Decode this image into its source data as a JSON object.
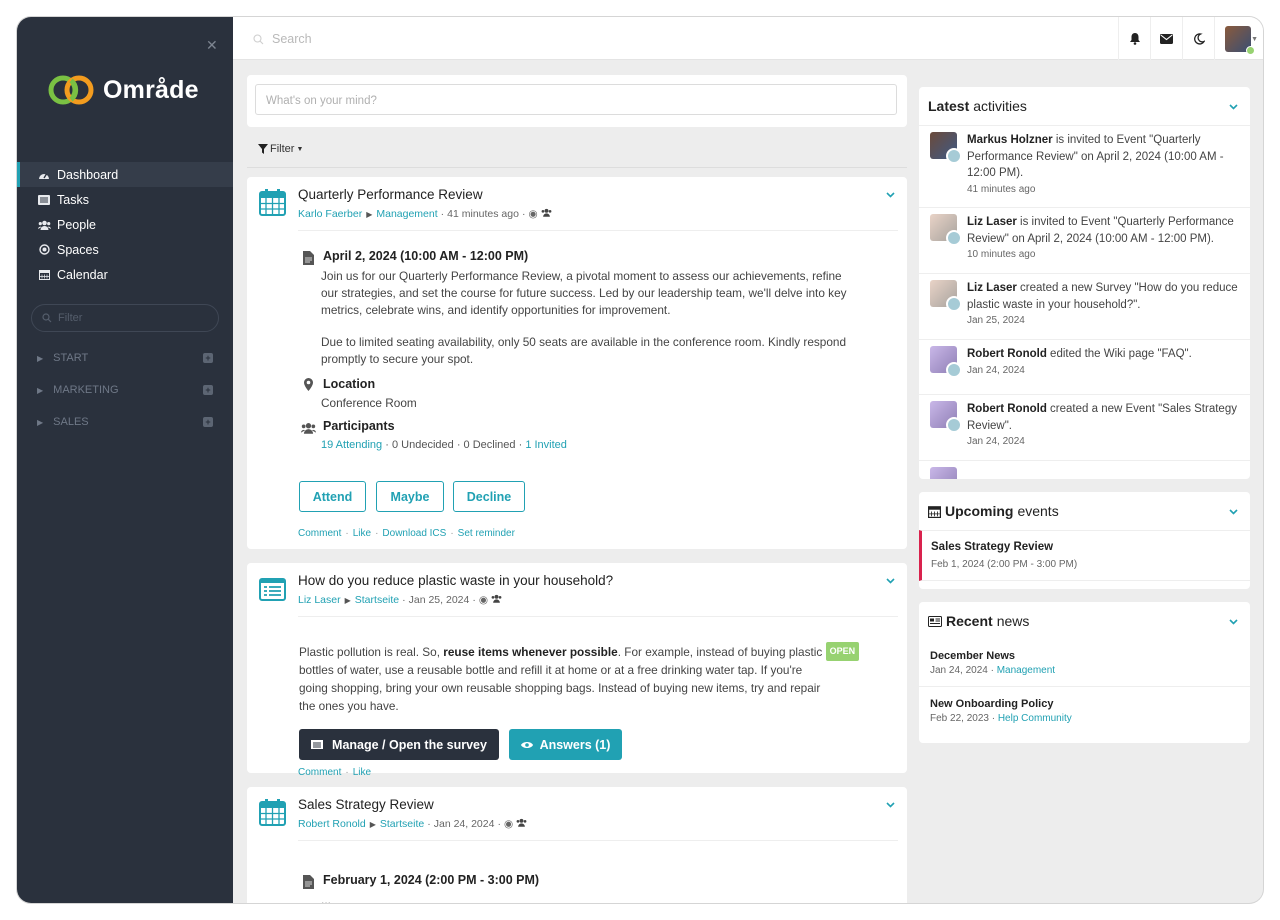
{
  "app": {
    "name": "Område"
  },
  "colors": {
    "sidebar": "#2a313d",
    "accent": "#21a1b3",
    "dark_button": "#2a313d",
    "open_badge": "#97d271",
    "event_marker": "#d9224d"
  },
  "sidebar": {
    "close_icon": "times-icon",
    "nav": [
      {
        "label": "Dashboard",
        "icon": "dashboard-icon",
        "active": true
      },
      {
        "label": "Tasks",
        "icon": "tasks-icon"
      },
      {
        "label": "People",
        "icon": "people-icon"
      },
      {
        "label": "Spaces",
        "icon": "spaces-icon"
      },
      {
        "label": "Calendar",
        "icon": "calendar-icon"
      }
    ],
    "filter_placeholder": "Filter",
    "groups": [
      "START",
      "MARKETING",
      "SALES"
    ]
  },
  "topbar": {
    "search_placeholder": "Search",
    "icons": [
      "bell-icon",
      "envelope-icon",
      "moon-icon"
    ]
  },
  "composer": {
    "placeholder": "What's on your mind?"
  },
  "filter": {
    "label": "Filter"
  },
  "posts": [
    {
      "title": "Quarterly Performance Review",
      "author": "Karlo Faerber",
      "space": "Management",
      "time": "41 minutes ago",
      "date_line": "April 2, 2024 (10:00 AM - 12:00 PM)",
      "description": "Join us for our Quarterly Performance Review, a pivotal moment to assess our achievements, refine our strategies, and set the course for future success. Led by our leadership team, we'll delve into key metrics, celebrate wins, and identify opportunities for improvement.",
      "description2": "Due to limited seating availability, only 50 seats are available in the conference room. Kindly respond promptly to secure your spot.",
      "location_label": "Location",
      "location": "Conference Room",
      "participants_label": "Participants",
      "attending": "19 Attending",
      "undecided": "0 Undecided",
      "declined": "0 Declined",
      "invited": "1 Invited",
      "buttons": [
        "Attend",
        "Maybe",
        "Decline"
      ],
      "actions": [
        "Comment",
        "Like",
        "Download ICS",
        "Set reminder"
      ]
    },
    {
      "title": "How do you reduce plastic waste in your household?",
      "author": "Liz Laser",
      "space": "Startseite",
      "time": "Jan 25, 2024",
      "text_a": "Plastic pollution is real. So, ",
      "text_bold": "reuse items whenever possible",
      "text_b": ". For example, instead of buying plastic",
      "line2": "bottles of water, use a reusable bottle and refill it at home or at a free drinking water tap. If you're",
      "line3": "going shopping, bring your own reusable shopping bags. Instead of buying new items, try and repair",
      "line4": "the ones you have.",
      "badge": "OPEN",
      "manage_label": "Manage / Open the survey",
      "answers_label": "Answers (1)",
      "actions": [
        "Comment",
        "Like"
      ]
    },
    {
      "title": "Sales Strategy Review",
      "author": "Robert Ronold",
      "space": "Startseite",
      "time": "Jan 24, 2024",
      "date_line": "February 1, 2024 (2:00 PM - 3:00 PM)",
      "ellipsis": "..."
    }
  ],
  "latest": {
    "title_bold": "Latest",
    "title_rest": "activities",
    "items": [
      {
        "name": "Markus Holzner",
        "text": " is invited to Event \"Quarterly Performance Review\" on April 2, 2024 (10:00 AM - 12:00 PM).",
        "time": "41 minutes ago"
      },
      {
        "name": "Liz Laser",
        "text": " is invited to Event \"Quarterly Performance Review\" on April 2, 2024 (10:00 AM - 12:00 PM).",
        "time": "10 minutes ago"
      },
      {
        "name": "Liz Laser",
        "text": " created a new Survey \"How do you reduce plastic waste in your household?\".",
        "time": "Jan 25, 2024"
      },
      {
        "name": "Robert Ronold",
        "text": " edited the Wiki page \"FAQ\".",
        "time": "Jan 24, 2024"
      },
      {
        "name": "Robert Ronold",
        "text": " created a new Event \"Sales Strategy Review\".",
        "time": "Jan 24, 2024"
      }
    ]
  },
  "upcoming": {
    "title_bold": "Upcoming",
    "title_rest": "events",
    "items": [
      {
        "title": "Sales Strategy Review",
        "time": "Feb 1, 2024 (2:00 PM - 3:00 PM)"
      }
    ]
  },
  "news": {
    "title_bold": "Recent",
    "title_rest": "news",
    "items": [
      {
        "title": "December News",
        "date": "Jan 24, 2024",
        "space": "Management"
      },
      {
        "title": "New Onboarding Policy",
        "date": "Feb 22, 2023",
        "space": "Help Community"
      }
    ]
  }
}
